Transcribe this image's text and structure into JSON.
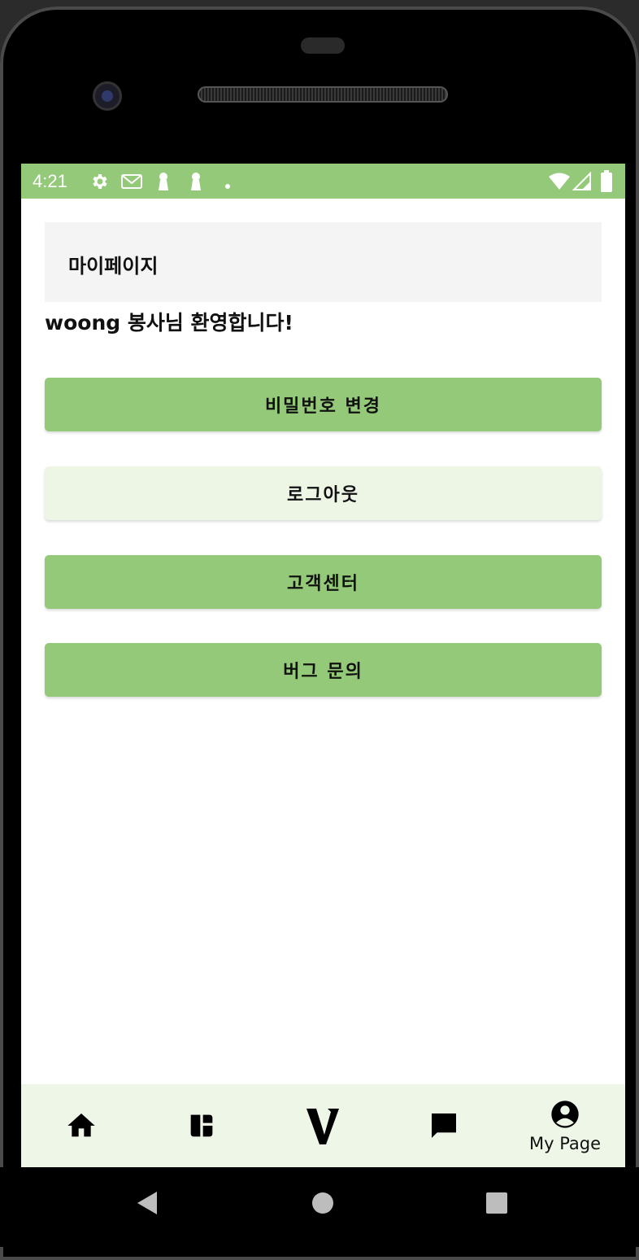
{
  "status_bar": {
    "time": "4:21",
    "left_icons": [
      "gear-icon",
      "gmail-icon",
      "keyhole-icon",
      "keyhole-icon",
      "dot-icon"
    ],
    "right_icons": [
      "wifi-icon",
      "signal-icon",
      "battery-icon"
    ],
    "color": "#93c978"
  },
  "header": {
    "title": "마이페이지"
  },
  "welcome_text": "woong 봉사님 환영합니다!",
  "buttons": [
    {
      "label": "비밀번호 변경",
      "style": "primary"
    },
    {
      "label": "로그아웃",
      "style": "light"
    },
    {
      "label": "고객센터",
      "style": "primary"
    },
    {
      "label": "버그 문의",
      "style": "primary"
    }
  ],
  "bottom_nav": {
    "items": [
      {
        "icon": "home-icon",
        "label": ""
      },
      {
        "icon": "dashboard-icon",
        "label": ""
      },
      {
        "icon": "v-logo-icon",
        "label": ""
      },
      {
        "icon": "chat-icon",
        "label": ""
      },
      {
        "icon": "account-circle-icon",
        "label": "My Page",
        "active": true
      }
    ]
  },
  "colors": {
    "accent": "#93c978",
    "light_accent": "#edf6e5",
    "nav_bg": "#eef6e7"
  }
}
